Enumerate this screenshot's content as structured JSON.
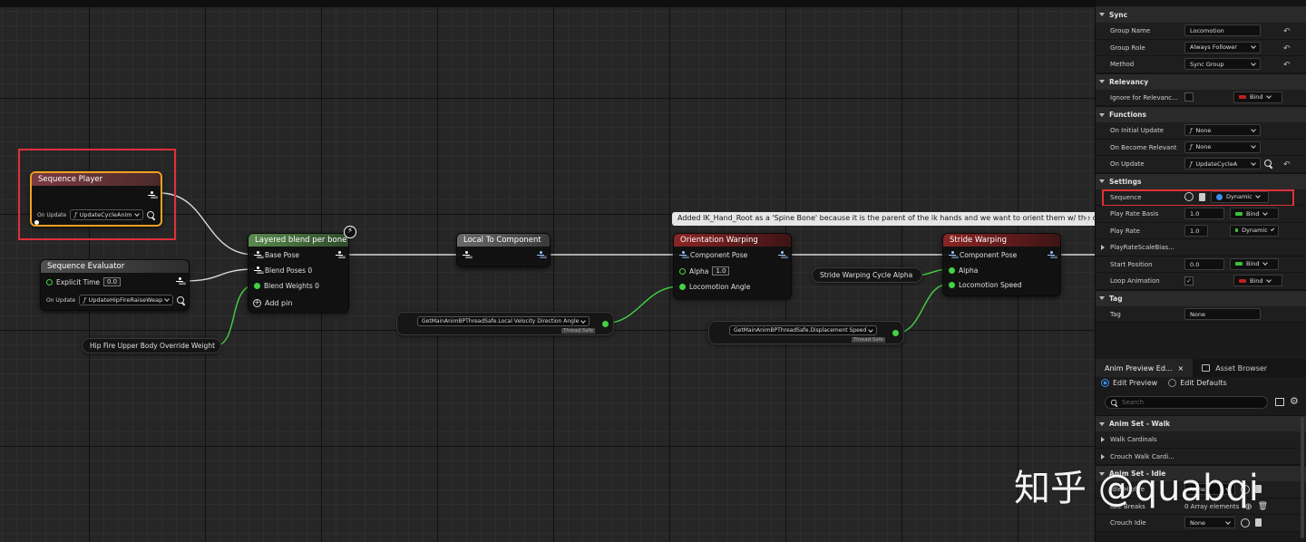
{
  "graph": {
    "comment": "Added IK_Hand_Root as a 'Spine Bone' because it is the parent of the ik hands and we want to orient them w/ the chest.",
    "sequence_player": {
      "title": "Sequence Player",
      "on_update_label": "On Update",
      "on_update_value": "UpdateCycleAnim"
    },
    "sequence_evaluator": {
      "title": "Sequence Evaluator",
      "explicit_time_label": "Explicit Time",
      "explicit_time_value": "0.0",
      "on_update_label": "On Update",
      "on_update_value": "UpdateHipFireRaiseWeap"
    },
    "layered_blend": {
      "title": "Layered blend per bone",
      "base_pose": "Base Pose",
      "blend_poses": "Blend Poses 0",
      "blend_weights": "Blend Weights 0",
      "add_pin": "Add pin"
    },
    "hip_fire_weight": "Hip Fire Upper Body Override Weight",
    "local_to_component": {
      "title": "Local To Component"
    },
    "orientation_warping": {
      "title": "Orientation Warping",
      "component_pose": "Component Pose",
      "alpha_label": "Alpha",
      "alpha_value": "1.0",
      "locomotion_angle": "Locomotion Angle"
    },
    "getter_direction": {
      "value": "GetMainAnimBPThreadSafe.Local Velocity Direction Angle",
      "thread_safe": "Thread Safe"
    },
    "stride_alpha": "Stride Warping Cycle Alpha",
    "stride_warping": {
      "title": "Stride Warping",
      "component_pose": "Component Pose",
      "alpha": "Alpha",
      "locomotion_speed": "Locomotion Speed"
    },
    "getter_speed": {
      "value": "GetMainAnimBPThreadSafe.Displacement Speed",
      "thread_safe": "Thread Safe"
    }
  },
  "details": {
    "sync": {
      "title": "Sync",
      "group_name_label": "Group Name",
      "group_name_value": "Locomotion",
      "group_role_label": "Group Role",
      "group_role_value": "Always Follower",
      "method_label": "Method",
      "method_value": "Sync Group"
    },
    "relevancy": {
      "title": "Relevancy",
      "ignore_label": "Ignore for Relevanc...",
      "bind_label": "Bind"
    },
    "functions": {
      "title": "Functions",
      "initial_update_label": "On Initial Update",
      "initial_update_value": "None",
      "become_relevant_label": "On Become Relevant",
      "become_relevant_value": "None",
      "on_update_label": "On Update",
      "on_update_value": "UpdateCycleA"
    },
    "settings": {
      "title": "Settings",
      "sequence_label": "Sequence",
      "sequence_value": "Dynamic",
      "play_rate_basis_label": "Play Rate Basis",
      "play_rate_basis_value": "1.0",
      "play_rate_basis_bind": "Bind",
      "play_rate_label": "Play Rate",
      "play_rate_value": "1.0",
      "play_rate_bind": "Dynamic",
      "scale_bias_label": "PlayRateScaleBias...",
      "start_position_label": "Start Position",
      "start_position_value": "0.0",
      "start_position_bind": "Bind",
      "loop_label": "Loop Animation",
      "loop_bind": "Bind"
    },
    "tag": {
      "title": "Tag",
      "tag_label": "Tag",
      "tag_value": "None"
    }
  },
  "preview": {
    "tab_preview": "Anim Preview Ed...",
    "tab_asset": "Asset Browser",
    "edit_preview": "Edit Preview",
    "edit_defaults": "Edit Defaults",
    "search_placeholder": "Search",
    "anim_set_walk": "Anim Set - Walk",
    "walk_cardinals": "Walk Cardinals",
    "crouch_walk": "Crouch Walk Cardi...",
    "anim_set_idle": "Anim Set - Idle",
    "idle_hipfire_label": "Idle Hipfire",
    "idle_hipfire_value": "None",
    "idle_breaks_label": "Idle Breaks",
    "idle_breaks_value": "0 Array elements",
    "crouch_idle_label": "Crouch Idle",
    "crouch_idle_value": "None"
  },
  "watermark": "知乎 @quabqi",
  "colors": {
    "highlight_red": "#e0303a",
    "float_pin": "#44d144",
    "pose_pin": "#ffffff",
    "component_pin": "#9ec8ff"
  }
}
